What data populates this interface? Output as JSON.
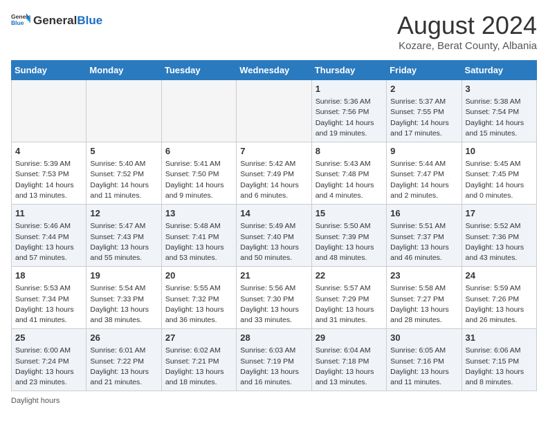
{
  "header": {
    "logo_general": "General",
    "logo_blue": "Blue",
    "month_title": "August 2024",
    "subtitle": "Kozare, Berat County, Albania"
  },
  "weekdays": [
    "Sunday",
    "Monday",
    "Tuesday",
    "Wednesday",
    "Thursday",
    "Friday",
    "Saturday"
  ],
  "weeks": [
    [
      {
        "day": "",
        "info": "",
        "empty": true
      },
      {
        "day": "",
        "info": "",
        "empty": true
      },
      {
        "day": "",
        "info": "",
        "empty": true
      },
      {
        "day": "",
        "info": "",
        "empty": true
      },
      {
        "day": "1",
        "info": "Sunrise: 5:36 AM\nSunset: 7:56 PM\nDaylight: 14 hours\nand 19 minutes."
      },
      {
        "day": "2",
        "info": "Sunrise: 5:37 AM\nSunset: 7:55 PM\nDaylight: 14 hours\nand 17 minutes."
      },
      {
        "day": "3",
        "info": "Sunrise: 5:38 AM\nSunset: 7:54 PM\nDaylight: 14 hours\nand 15 minutes."
      }
    ],
    [
      {
        "day": "4",
        "info": "Sunrise: 5:39 AM\nSunset: 7:53 PM\nDaylight: 14 hours\nand 13 minutes."
      },
      {
        "day": "5",
        "info": "Sunrise: 5:40 AM\nSunset: 7:52 PM\nDaylight: 14 hours\nand 11 minutes."
      },
      {
        "day": "6",
        "info": "Sunrise: 5:41 AM\nSunset: 7:50 PM\nDaylight: 14 hours\nand 9 minutes."
      },
      {
        "day": "7",
        "info": "Sunrise: 5:42 AM\nSunset: 7:49 PM\nDaylight: 14 hours\nand 6 minutes."
      },
      {
        "day": "8",
        "info": "Sunrise: 5:43 AM\nSunset: 7:48 PM\nDaylight: 14 hours\nand 4 minutes."
      },
      {
        "day": "9",
        "info": "Sunrise: 5:44 AM\nSunset: 7:47 PM\nDaylight: 14 hours\nand 2 minutes."
      },
      {
        "day": "10",
        "info": "Sunrise: 5:45 AM\nSunset: 7:45 PM\nDaylight: 14 hours\nand 0 minutes."
      }
    ],
    [
      {
        "day": "11",
        "info": "Sunrise: 5:46 AM\nSunset: 7:44 PM\nDaylight: 13 hours\nand 57 minutes."
      },
      {
        "day": "12",
        "info": "Sunrise: 5:47 AM\nSunset: 7:43 PM\nDaylight: 13 hours\nand 55 minutes."
      },
      {
        "day": "13",
        "info": "Sunrise: 5:48 AM\nSunset: 7:41 PM\nDaylight: 13 hours\nand 53 minutes."
      },
      {
        "day": "14",
        "info": "Sunrise: 5:49 AM\nSunset: 7:40 PM\nDaylight: 13 hours\nand 50 minutes."
      },
      {
        "day": "15",
        "info": "Sunrise: 5:50 AM\nSunset: 7:39 PM\nDaylight: 13 hours\nand 48 minutes."
      },
      {
        "day": "16",
        "info": "Sunrise: 5:51 AM\nSunset: 7:37 PM\nDaylight: 13 hours\nand 46 minutes."
      },
      {
        "day": "17",
        "info": "Sunrise: 5:52 AM\nSunset: 7:36 PM\nDaylight: 13 hours\nand 43 minutes."
      }
    ],
    [
      {
        "day": "18",
        "info": "Sunrise: 5:53 AM\nSunset: 7:34 PM\nDaylight: 13 hours\nand 41 minutes."
      },
      {
        "day": "19",
        "info": "Sunrise: 5:54 AM\nSunset: 7:33 PM\nDaylight: 13 hours\nand 38 minutes."
      },
      {
        "day": "20",
        "info": "Sunrise: 5:55 AM\nSunset: 7:32 PM\nDaylight: 13 hours\nand 36 minutes."
      },
      {
        "day": "21",
        "info": "Sunrise: 5:56 AM\nSunset: 7:30 PM\nDaylight: 13 hours\nand 33 minutes."
      },
      {
        "day": "22",
        "info": "Sunrise: 5:57 AM\nSunset: 7:29 PM\nDaylight: 13 hours\nand 31 minutes."
      },
      {
        "day": "23",
        "info": "Sunrise: 5:58 AM\nSunset: 7:27 PM\nDaylight: 13 hours\nand 28 minutes."
      },
      {
        "day": "24",
        "info": "Sunrise: 5:59 AM\nSunset: 7:26 PM\nDaylight: 13 hours\nand 26 minutes."
      }
    ],
    [
      {
        "day": "25",
        "info": "Sunrise: 6:00 AM\nSunset: 7:24 PM\nDaylight: 13 hours\nand 23 minutes."
      },
      {
        "day": "26",
        "info": "Sunrise: 6:01 AM\nSunset: 7:22 PM\nDaylight: 13 hours\nand 21 minutes."
      },
      {
        "day": "27",
        "info": "Sunrise: 6:02 AM\nSunset: 7:21 PM\nDaylight: 13 hours\nand 18 minutes."
      },
      {
        "day": "28",
        "info": "Sunrise: 6:03 AM\nSunset: 7:19 PM\nDaylight: 13 hours\nand 16 minutes."
      },
      {
        "day": "29",
        "info": "Sunrise: 6:04 AM\nSunset: 7:18 PM\nDaylight: 13 hours\nand 13 minutes."
      },
      {
        "day": "30",
        "info": "Sunrise: 6:05 AM\nSunset: 7:16 PM\nDaylight: 13 hours\nand 11 minutes."
      },
      {
        "day": "31",
        "info": "Sunrise: 6:06 AM\nSunset: 7:15 PM\nDaylight: 13 hours\nand 8 minutes."
      }
    ]
  ],
  "footer": {
    "daylight_label": "Daylight hours"
  }
}
